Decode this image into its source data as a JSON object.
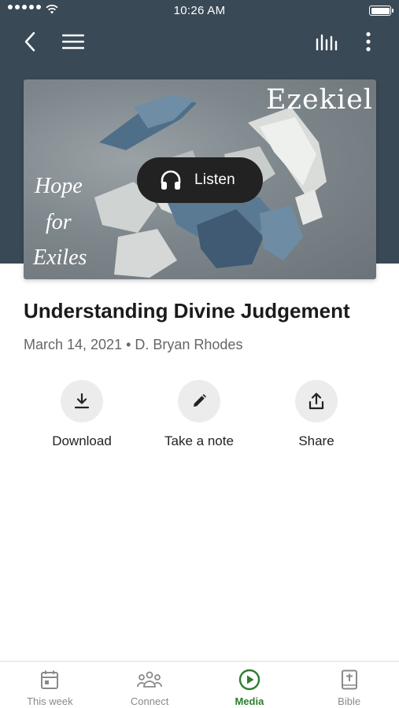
{
  "status_bar": {
    "time": "10:26 AM"
  },
  "hero": {
    "series_title": "Ezekiel",
    "cover_lines": [
      "Hope",
      "for",
      "Exiles"
    ],
    "listen_label": "Listen"
  },
  "sermon": {
    "title": "Understanding Divine Judgement",
    "meta": "March 14, 2021 • D. Bryan Rhodes"
  },
  "actions": [
    {
      "label": "Download",
      "icon": "download-icon"
    },
    {
      "label": "Take a note",
      "icon": "pencil-icon"
    },
    {
      "label": "Share",
      "icon": "share-icon"
    }
  ],
  "tabs": [
    {
      "label": "This week",
      "icon": "calendar-icon",
      "active": false
    },
    {
      "label": "Connect",
      "icon": "people-icon",
      "active": false
    },
    {
      "label": "Media",
      "icon": "play-circle-icon",
      "active": true
    },
    {
      "label": "Bible",
      "icon": "bible-icon",
      "active": false
    }
  ],
  "colors": {
    "header": "#3a4956",
    "accent": "#2e7d32",
    "tab_inactive": "#8a8a8a"
  }
}
